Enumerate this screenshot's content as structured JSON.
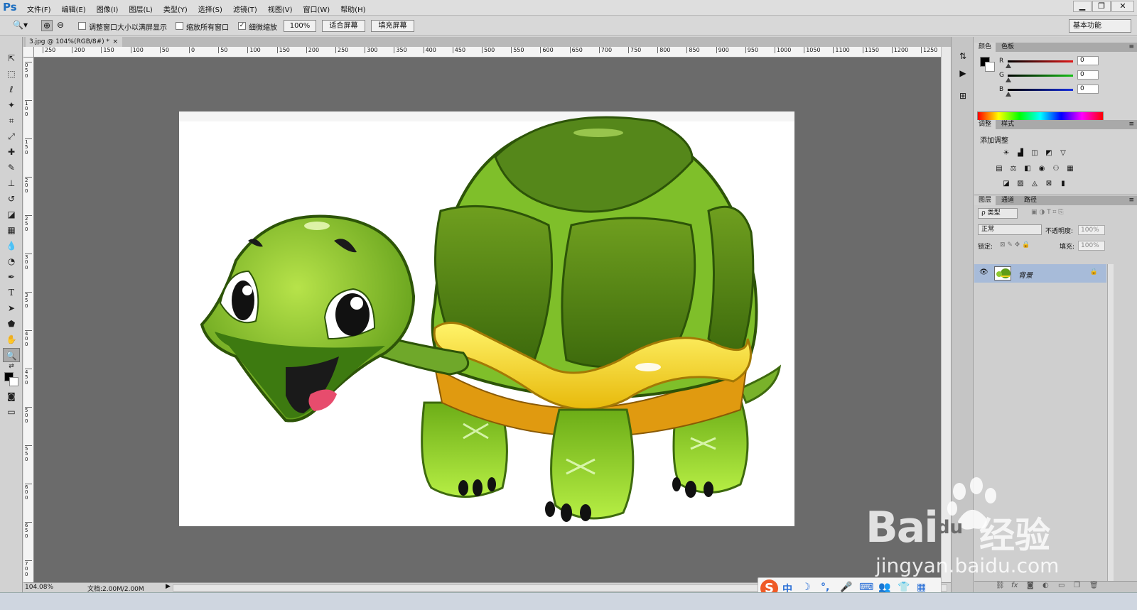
{
  "app": {
    "logo": "Ps"
  },
  "menubar": {
    "items": [
      "文件(F)",
      "编辑(E)",
      "图像(I)",
      "图层(L)",
      "类型(Y)",
      "选择(S)",
      "滤镜(T)",
      "视图(V)",
      "窗口(W)",
      "帮助(H)"
    ]
  },
  "window_controls": {
    "minimize": "▁",
    "restore": "❐",
    "close": "✕"
  },
  "options": {
    "resize_windows": {
      "label": "调整窗口大小以满屏显示",
      "checked": false
    },
    "zoom_all": {
      "label": "缩放所有窗口",
      "checked": false
    },
    "scrubby_zoom": {
      "label": "细微缩放",
      "checked": true
    },
    "zoom_value": "100%",
    "fit_screen": "适合屏幕",
    "fill_screen": "填充屏幕",
    "workspace": "基本功能"
  },
  "document": {
    "tab_title": "3.jpg @ 104%(RGB/8#) *",
    "close": "×"
  },
  "rulers": {
    "horizontal": [
      "250",
      "200",
      "150",
      "100",
      "50",
      "0",
      "50",
      "100",
      "150",
      "200",
      "250",
      "300",
      "350",
      "400",
      "450",
      "500",
      "550",
      "600",
      "650",
      "700",
      "750",
      "800",
      "850",
      "900",
      "950",
      "1000",
      "1050",
      "1100",
      "1150",
      "1200",
      "1250"
    ],
    "vertical": [
      "0",
      "5",
      "0",
      "1",
      "0",
      "0",
      "1",
      "5",
      "0",
      "2",
      "0",
      "0",
      "2",
      "5",
      "0",
      "3",
      "0",
      "0",
      "3",
      "5",
      "0",
      "4",
      "0",
      "0",
      "4",
      "5",
      "0",
      "5",
      "0",
      "0",
      "5",
      "5",
      "0",
      "6",
      "0",
      "0",
      "6",
      "5",
      "0",
      "7",
      "0",
      "0"
    ]
  },
  "status": {
    "zoom": "104.08%",
    "doc": "文档:2.00M/2.00M"
  },
  "color_panel": {
    "tabs": [
      "颜色",
      "色板"
    ],
    "channels": [
      {
        "name": "R",
        "value": "0",
        "color": "#e01818"
      },
      {
        "name": "G",
        "value": "0",
        "color": "#18c018"
      },
      {
        "name": "B",
        "value": "0",
        "color": "#1830e0"
      }
    ]
  },
  "adjust_panel": {
    "tabs": [
      "调整",
      "样式"
    ],
    "title": "添加调整"
  },
  "layers_panel": {
    "tabs": [
      "图层",
      "通道",
      "路径"
    ],
    "kind_filter": "ρ 类型",
    "blend_mode": "正常",
    "opacity_label": "不透明度:",
    "opacity_value": "100%",
    "lock_label": "锁定:",
    "fill_label": "填充:",
    "fill_value": "100%",
    "layer_name": "背景"
  },
  "ime": {
    "items": [
      "中",
      "☽",
      "°,",
      "🎤",
      "⌨",
      "👥",
      "👕",
      "▦"
    ]
  },
  "watermark": {
    "brand": "Bai",
    "paw": "du",
    "product": "经验",
    "url": "jingyan.baidu.com"
  }
}
